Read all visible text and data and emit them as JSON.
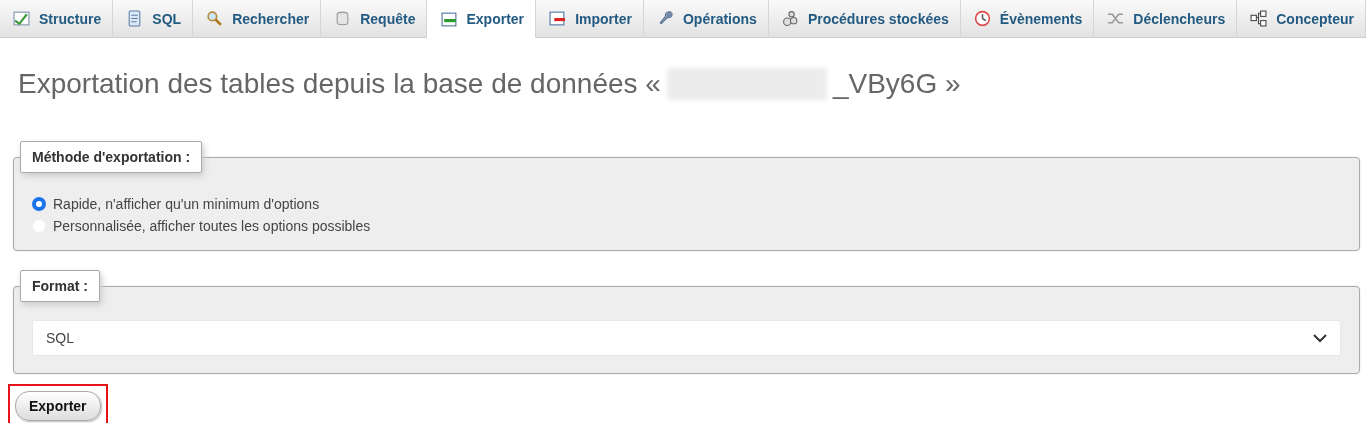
{
  "tabs": [
    {
      "label": "Structure",
      "selected": false
    },
    {
      "label": "SQL",
      "selected": false
    },
    {
      "label": "Rechercher",
      "selected": false
    },
    {
      "label": "Requête",
      "selected": false
    },
    {
      "label": "Exporter",
      "selected": true
    },
    {
      "label": "Importer",
      "selected": false
    },
    {
      "label": "Opérations",
      "selected": false
    },
    {
      "label": "Procédures stockées",
      "selected": false
    },
    {
      "label": "Évènements",
      "selected": false
    },
    {
      "label": "Déclencheurs",
      "selected": false
    },
    {
      "label": "Concepteur",
      "selected": false
    }
  ],
  "title": {
    "before": "Exportation des tables depuis la base de données «",
    "redacted": true,
    "after": "_VBy6G »"
  },
  "method": {
    "legend": "Méthode d'exportation :",
    "options": [
      {
        "label": "Rapide, n'afficher qu'un minimum d'options",
        "selected": true
      },
      {
        "label": "Personnalisée, afficher toutes les options possibles",
        "selected": false
      }
    ]
  },
  "format": {
    "legend": "Format :",
    "value": "SQL"
  },
  "export_button": {
    "label": "Exporter",
    "highlighted": true
  }
}
